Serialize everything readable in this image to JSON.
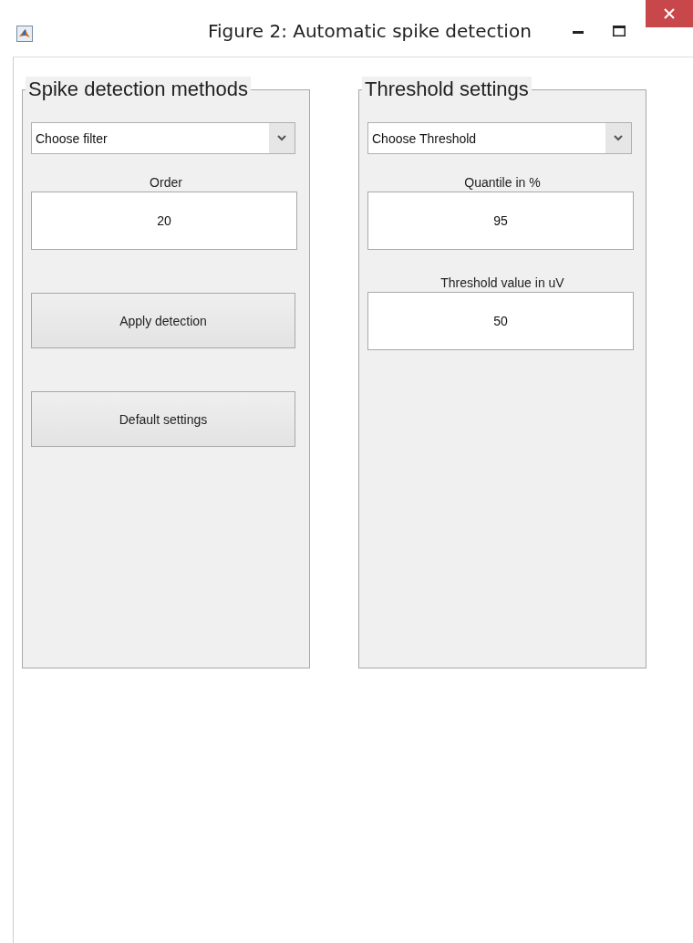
{
  "window": {
    "title": "Figure 2: Automatic spike detection"
  },
  "panels": [
    {
      "title": "Spike detection methods",
      "controls": [
        {
          "kind": "dropdown",
          "value": "Choose filter"
        },
        {
          "kind": "label",
          "text": "Order"
        },
        {
          "kind": "field",
          "value": "20"
        },
        {
          "kind": "button",
          "label": "Apply detection"
        },
        {
          "kind": "button",
          "label": "Default settings"
        }
      ]
    },
    {
      "title": "Threshold settings",
      "controls": [
        {
          "kind": "dropdown",
          "value": "Choose Threshold"
        },
        {
          "kind": "label",
          "text": "Quantile in %"
        },
        {
          "kind": "field",
          "value": "95"
        },
        {
          "kind": "label",
          "text": "Threshold value in uV"
        },
        {
          "kind": "field",
          "value": "50"
        }
      ]
    }
  ]
}
